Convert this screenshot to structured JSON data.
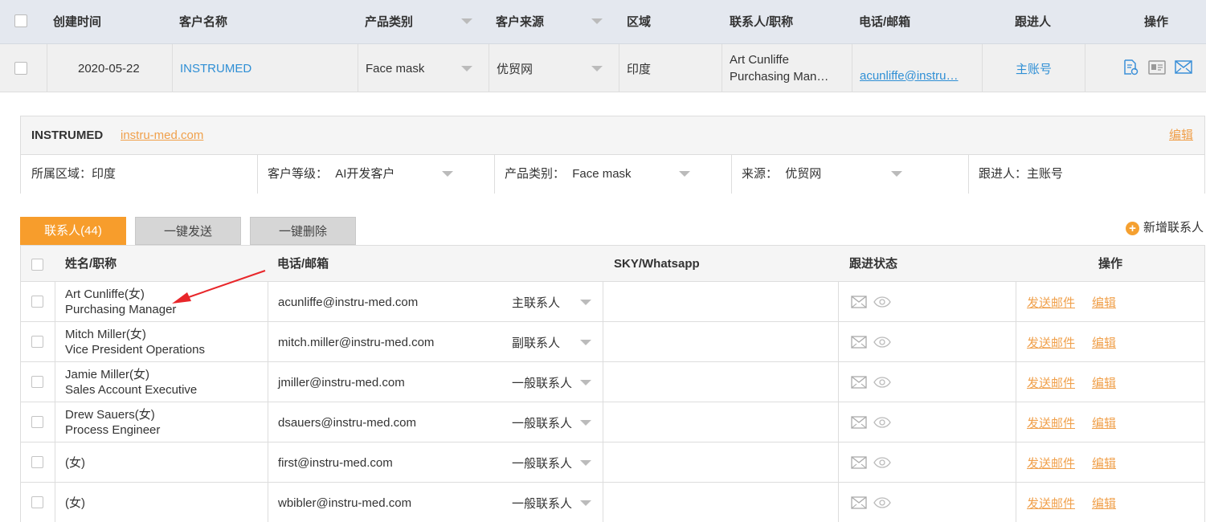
{
  "top_table": {
    "headers": {
      "created": "创建时间",
      "customer": "客户名称",
      "product": "产品类别",
      "source": "客户来源",
      "region": "区域",
      "contact": "联系人/职称",
      "phone_email": "电话/邮箱",
      "follower": "跟进人",
      "actions": "操作"
    },
    "row": {
      "created": "2020-05-22",
      "customer": "INSTRUMED",
      "product": "Face mask",
      "source": "优贸网",
      "region": "印度",
      "contact_name": "Art Cunliffe",
      "contact_title": "Purchasing Man…",
      "email": "acunliffe@instru…",
      "follower": "主账号"
    }
  },
  "company_panel": {
    "name": "INSTRUMED",
    "website": "instru-med.com",
    "edit_label": "编辑",
    "region_label": "所属区域：",
    "region_value": "印度",
    "level_label": "客户等级：",
    "level_value": "AI开发客户",
    "product_label": "产品类别：",
    "product_value": "Face mask",
    "source_label": "来源：",
    "source_value": "优贸网",
    "follower_label": "跟进人：",
    "follower_value": "主账号"
  },
  "tabs": {
    "contacts": "联系人(44)",
    "send_all": "一键发送",
    "delete_all": "一键删除",
    "add_contact": "新增联系人"
  },
  "contacts_table": {
    "headers": {
      "name_title": "姓名/职称",
      "phone_email": "电话/邮箱",
      "sky": "SKY/Whatsapp",
      "status": "跟进状态",
      "actions": "操作"
    },
    "send_label": "发送邮件",
    "edit_label": "编辑",
    "rows": [
      {
        "name": "Art Cunliffe(女)",
        "title": "Purchasing Manager",
        "email": "acunliffe@instru-med.com",
        "role": "主联系人"
      },
      {
        "name": "Mitch Miller(女)",
        "title": "Vice President Operations",
        "email": "mitch.miller@instru-med.com",
        "role": "副联系人"
      },
      {
        "name": "Jamie Miller(女)",
        "title": "Sales Account Executive",
        "email": "jmiller@instru-med.com",
        "role": "一般联系人"
      },
      {
        "name": "Drew Sauers(女)",
        "title": "Process Engineer",
        "email": "dsauers@instru-med.com",
        "role": "一般联系人"
      },
      {
        "name": "(女)",
        "title": "",
        "email": "first@instru-med.com",
        "role": "一般联系人"
      },
      {
        "name": "(女)",
        "title": "",
        "email": "wbibler@instru-med.com",
        "role": "一般联系人"
      }
    ]
  },
  "colors": {
    "accent_orange": "#f79d2c",
    "link_blue": "#2f8fd5",
    "arrow_red": "#e8262a"
  }
}
